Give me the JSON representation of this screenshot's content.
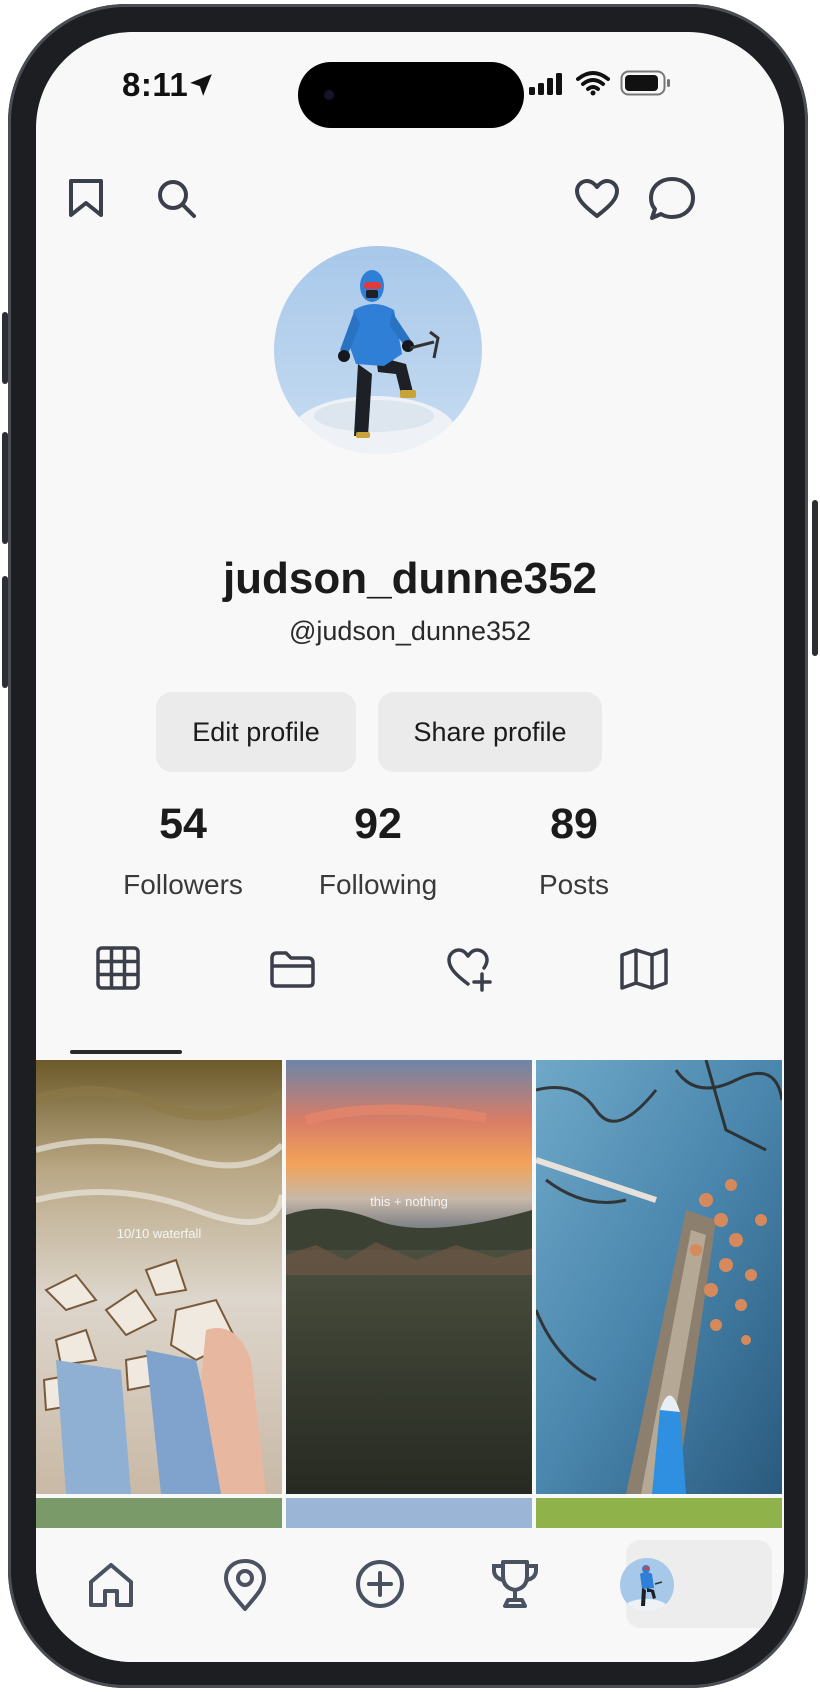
{
  "status_bar": {
    "time": "8:11"
  },
  "header": {
    "left_icons": [
      "bookmark-icon",
      "search-icon"
    ],
    "right_icons": [
      "heart-icon",
      "chat-bubble-icon"
    ]
  },
  "profile": {
    "username": "judson_dunne352",
    "handle": "@judson_dunne352",
    "edit_label": "Edit profile",
    "share_label": "Share profile"
  },
  "stats": [
    {
      "value": "54",
      "label": "Followers"
    },
    {
      "value": "92",
      "label": "Following"
    },
    {
      "value": "89",
      "label": "Posts"
    }
  ],
  "tabs": [
    {
      "icon": "grid-icon",
      "active": true
    },
    {
      "icon": "folder-icon",
      "active": false
    },
    {
      "icon": "heart-plus-icon",
      "active": false
    },
    {
      "icon": "map-icon",
      "active": false
    }
  ],
  "posts": [
    {
      "caption": "10/10 waterfall"
    },
    {
      "caption": "this + nothing"
    },
    {
      "caption": ""
    }
  ],
  "bottom_nav": [
    {
      "icon": "home-icon",
      "active": false
    },
    {
      "icon": "location-pin-icon",
      "active": false
    },
    {
      "icon": "plus-circle-icon",
      "active": false
    },
    {
      "icon": "trophy-icon",
      "active": false
    },
    {
      "icon": "avatar",
      "active": true
    }
  ],
  "colors": {
    "icon": "#3a3f4a",
    "accent_sky": "#a9c9ec",
    "jacket": "#2f7fd6"
  }
}
